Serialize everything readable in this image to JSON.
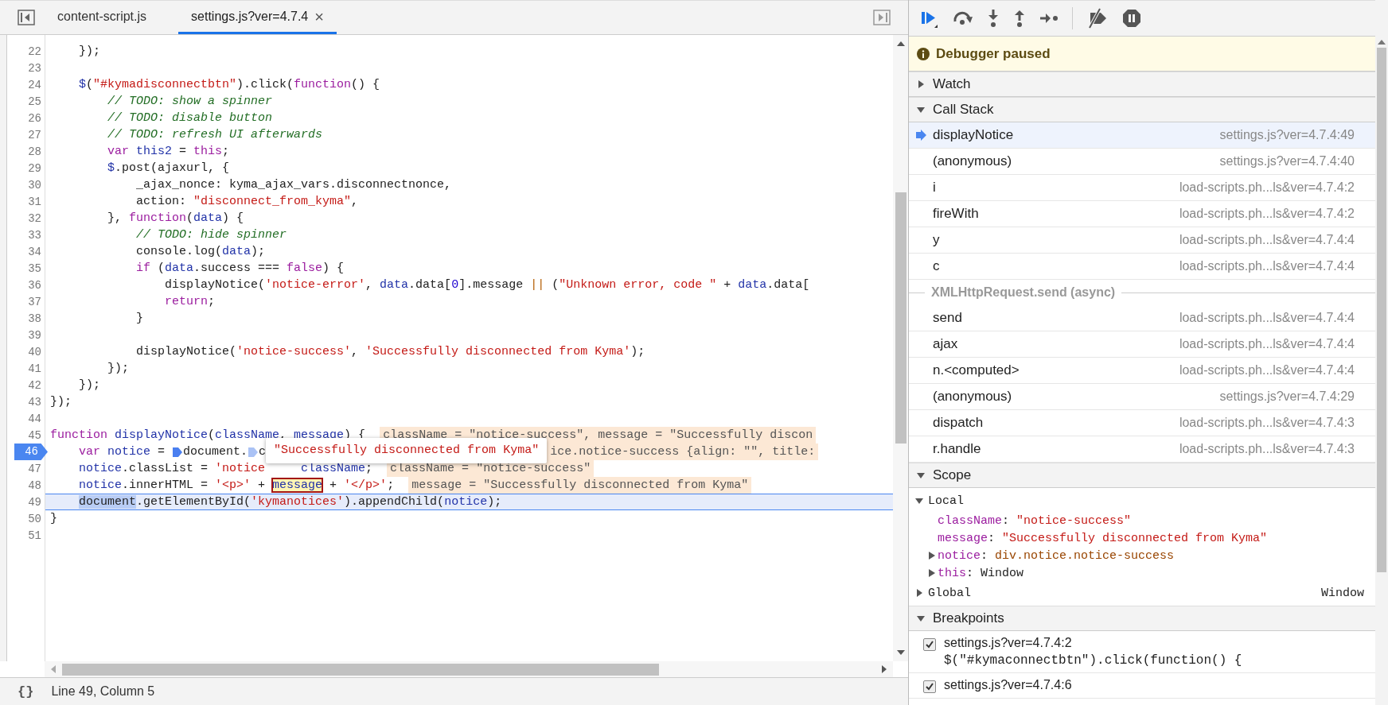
{
  "editor": {
    "tabs": [
      {
        "label": "content-script.js",
        "selected": false
      },
      {
        "label": "settings.js?ver=4.7.4",
        "selected": true,
        "close": "×"
      }
    ],
    "lines": [
      {
        "number": "22",
        "breakpoint": false,
        "current": false,
        "tokens": [
          {
            "kind": "plain",
            "text": "    });"
          }
        ]
      },
      {
        "number": "23",
        "breakpoint": false,
        "current": false
      },
      {
        "number": "24",
        "breakpoint": false,
        "current": false,
        "tokens": [
          {
            "kind": "variable",
            "text": "    $"
          },
          {
            "kind": "plain",
            "text": "("
          },
          {
            "kind": "string",
            "text": "\"#kymadisconnectbtn\""
          },
          {
            "kind": "plain",
            "text": ").click("
          },
          {
            "kind": "keyword",
            "text": "function"
          },
          {
            "kind": "plain",
            "text": "() {"
          }
        ]
      },
      {
        "number": "25",
        "breakpoint": false,
        "current": false,
        "tokens": [
          {
            "kind": "comment",
            "text": "        // TODO: show a spinner"
          }
        ]
      },
      {
        "number": "26",
        "breakpoint": false,
        "current": false,
        "tokens": [
          {
            "kind": "comment",
            "text": "        // TODO: disable button"
          }
        ]
      },
      {
        "number": "27",
        "breakpoint": false,
        "current": false,
        "tokens": [
          {
            "kind": "comment",
            "text": "        // TODO: refresh UI afterwards"
          }
        ]
      },
      {
        "number": "28",
        "breakpoint": false,
        "current": false,
        "tokens": [
          {
            "kind": "keyword",
            "text": "        var"
          },
          {
            "kind": "variable",
            "text": " this2"
          },
          {
            "kind": "plain",
            "text": " = "
          },
          {
            "kind": "keyword",
            "text": "this"
          },
          {
            "kind": "plain",
            "text": ";"
          }
        ]
      },
      {
        "number": "29",
        "breakpoint": false,
        "current": false,
        "tokens": [
          {
            "kind": "variable",
            "text": "        $"
          },
          {
            "kind": "plain",
            "text": ".post(ajaxurl, {"
          }
        ]
      },
      {
        "number": "30",
        "breakpoint": false,
        "current": false,
        "tokens": [
          {
            "kind": "plain",
            "text": "            _ajax_nonce: kyma_ajax_vars.disconnectnonce,"
          }
        ]
      },
      {
        "number": "31",
        "breakpoint": false,
        "current": false,
        "tokens": [
          {
            "kind": "plain",
            "text": "            action: "
          },
          {
            "kind": "string",
            "text": "\"disconnect_from_kyma\""
          },
          {
            "kind": "plain",
            "text": ","
          }
        ]
      },
      {
        "number": "32",
        "breakpoint": false,
        "current": false,
        "tokens": [
          {
            "kind": "plain",
            "text": "        }, "
          },
          {
            "kind": "keyword",
            "text": "function"
          },
          {
            "kind": "plain",
            "text": "("
          },
          {
            "kind": "variable",
            "text": "data"
          },
          {
            "kind": "plain",
            "text": ") {"
          }
        ]
      },
      {
        "number": "33",
        "breakpoint": false,
        "current": false,
        "tokens": [
          {
            "kind": "comment",
            "text": "            // TODO: hide spinner"
          }
        ]
      },
      {
        "number": "34",
        "breakpoint": false,
        "current": false,
        "tokens": [
          {
            "kind": "plain",
            "text": "            console.log("
          },
          {
            "kind": "variable",
            "text": "data"
          },
          {
            "kind": "plain",
            "text": ");"
          }
        ]
      },
      {
        "number": "35",
        "breakpoint": false,
        "current": false,
        "tokens": [
          {
            "kind": "keyword",
            "text": "            if"
          },
          {
            "kind": "plain",
            "text": " ("
          },
          {
            "kind": "variable",
            "text": "data"
          },
          {
            "kind": "plain",
            "text": ".success === "
          },
          {
            "kind": "keyword",
            "text": "false"
          },
          {
            "kind": "plain",
            "text": ") {"
          }
        ]
      },
      {
        "number": "36",
        "breakpoint": false,
        "current": false,
        "tokens": [
          {
            "kind": "plain",
            "text": "                displayNotice("
          },
          {
            "kind": "string",
            "text": "'notice-error'"
          },
          {
            "kind": "plain",
            "text": ", "
          },
          {
            "kind": "variable",
            "text": "data"
          },
          {
            "kind": "plain",
            "text": ".data["
          },
          {
            "kind": "number",
            "text": "0"
          },
          {
            "kind": "plain",
            "text": "].message "
          },
          {
            "kind": "operator",
            "text": "||"
          },
          {
            "kind": "plain",
            "text": " ("
          },
          {
            "kind": "string",
            "text": "\"Unknown error, code \""
          },
          {
            "kind": "plain",
            "text": " + "
          },
          {
            "kind": "variable",
            "text": "data"
          },
          {
            "kind": "plain",
            "text": ".data["
          }
        ]
      },
      {
        "number": "37",
        "breakpoint": false,
        "current": false,
        "tokens": [
          {
            "kind": "keyword",
            "text": "                return"
          },
          {
            "kind": "plain",
            "text": ";"
          }
        ]
      },
      {
        "number": "38",
        "breakpoint": false,
        "current": false,
        "tokens": [
          {
            "kind": "plain",
            "text": "            }"
          }
        ]
      },
      {
        "number": "39",
        "breakpoint": false,
        "current": false
      },
      {
        "number": "40",
        "breakpoint": false,
        "current": false,
        "tokens": [
          {
            "kind": "plain",
            "text": "            displayNotice("
          },
          {
            "kind": "string",
            "text": "'notice-success'"
          },
          {
            "kind": "plain",
            "text": ", "
          },
          {
            "kind": "string",
            "text": "'Successfully disconnected from Kyma'"
          },
          {
            "kind": "plain",
            "text": ");"
          }
        ]
      },
      {
        "number": "41",
        "breakpoint": false,
        "current": false,
        "tokens": [
          {
            "kind": "plain",
            "text": "        });"
          }
        ]
      },
      {
        "number": "42",
        "breakpoint": false,
        "current": false,
        "tokens": [
          {
            "kind": "plain",
            "text": "    });"
          }
        ]
      },
      {
        "number": "43",
        "breakpoint": false,
        "current": false,
        "tokens": [
          {
            "kind": "plain",
            "text": "});"
          }
        ]
      },
      {
        "number": "44",
        "breakpoint": false,
        "current": false
      },
      {
        "number": "45",
        "breakpoint": false,
        "current": false,
        "tokens": [
          {
            "kind": "keyword",
            "text": "function"
          },
          {
            "kind": "variable",
            "text": " displayNotice"
          },
          {
            "kind": "plain",
            "text": "("
          },
          {
            "kind": "variable",
            "text": "className"
          },
          {
            "kind": "plain",
            "text": ", "
          },
          {
            "kind": "variable",
            "text": "message"
          },
          {
            "kind": "plain",
            "text": ") {"
          }
        ],
        "inline_value": "className = \"notice-success\", message = \"Successfully discon"
      },
      {
        "number": "46",
        "breakpoint": true,
        "current": false,
        "tokens": [
          {
            "kind": "keyword",
            "text": "    var"
          },
          {
            "kind": "variable",
            "text": " notice"
          },
          {
            "kind": "plain",
            "text": " = "
          },
          {
            "kind": "marker",
            "active": true
          },
          {
            "kind": "plain",
            "text": "document."
          },
          {
            "kind": "marker",
            "active": false
          },
          {
            "kind": "plain",
            "text": "c"
          }
        ],
        "popover": "\"Successfully disconnected from Kyma\"",
        "inline_value": "ice.notice-success {align: \"\", title:"
      },
      {
        "number": "47",
        "breakpoint": false,
        "current": false,
        "tokens": [
          {
            "kind": "variable",
            "text": "    notice"
          },
          {
            "kind": "plain",
            "text": ".classList = "
          },
          {
            "kind": "string",
            "text": "'notice"
          },
          {
            "kind": "variable",
            "text": "     className"
          },
          {
            "kind": "plain",
            "text": ";"
          }
        ],
        "inline_value": "className = \"notice-success\""
      },
      {
        "number": "48",
        "breakpoint": false,
        "current": false,
        "tokens": [
          {
            "kind": "variable",
            "text": "    notice"
          },
          {
            "kind": "plain",
            "text": ".innerHTML = "
          },
          {
            "kind": "string",
            "text": "'<p>'"
          },
          {
            "kind": "plain",
            "text": " + "
          },
          {
            "kind": "hovered",
            "text": "message"
          },
          {
            "kind": "plain",
            "text": " + "
          },
          {
            "kind": "string",
            "text": "'</p>'"
          },
          {
            "kind": "plain",
            "text": ";"
          }
        ],
        "inline_value": "message = \"Successfully disconnected from Kyma\""
      },
      {
        "number": "49",
        "breakpoint": false,
        "current": true,
        "tokens": [
          {
            "kind": "selected",
            "text": "    document"
          },
          {
            "kind": "plain",
            "text": ".getElementById("
          },
          {
            "kind": "string",
            "text": "'kymanotices'"
          },
          {
            "kind": "plain",
            "text": ").appendChild("
          },
          {
            "kind": "variable",
            "text": "notice"
          },
          {
            "kind": "plain",
            "text": ");"
          }
        ]
      },
      {
        "number": "50",
        "breakpoint": false,
        "current": false,
        "tokens": [
          {
            "kind": "plain",
            "text": "}"
          }
        ]
      },
      {
        "number": "51",
        "breakpoint": false,
        "current": false
      }
    ],
    "status_bar": {
      "pretty_print": "{}",
      "position": "Line 49, Column 5"
    }
  },
  "debugger": {
    "banner": "Debugger paused",
    "watch": {
      "title": "Watch",
      "expanded": false
    },
    "call_stack": {
      "title": "Call Stack",
      "expanded": true,
      "frames": [
        {
          "kind": "frame",
          "name": "displayNotice",
          "location": "settings.js?ver=4.7.4:49",
          "selected": true
        },
        {
          "kind": "frame",
          "name": "(anonymous)",
          "location": "settings.js?ver=4.7.4:40",
          "selected": false
        },
        {
          "kind": "frame",
          "name": "i",
          "location": "load-scripts.ph...ls&ver=4.7.4:2",
          "selected": false
        },
        {
          "kind": "frame",
          "name": "fireWith",
          "location": "load-scripts.ph...ls&ver=4.7.4:2",
          "selected": false
        },
        {
          "kind": "frame",
          "name": "y",
          "location": "load-scripts.ph...ls&ver=4.7.4:4",
          "selected": false
        },
        {
          "kind": "frame",
          "name": "c",
          "location": "load-scripts.ph...ls&ver=4.7.4:4",
          "selected": false
        },
        {
          "kind": "async",
          "name": "XMLHttpRequest.send (async)"
        },
        {
          "kind": "frame",
          "name": "send",
          "location": "load-scripts.ph...ls&ver=4.7.4:4",
          "selected": false
        },
        {
          "kind": "frame",
          "name": "ajax",
          "location": "load-scripts.ph...ls&ver=4.7.4:4",
          "selected": false
        },
        {
          "kind": "frame",
          "name": "n.<computed>",
          "location": "load-scripts.ph...ls&ver=4.7.4:4",
          "selected": false
        },
        {
          "kind": "frame",
          "name": "(anonymous)",
          "location": "settings.js?ver=4.7.4:29",
          "selected": false
        },
        {
          "kind": "frame",
          "name": "dispatch",
          "location": "load-scripts.ph...ls&ver=4.7.4:3",
          "selected": false
        },
        {
          "kind": "frame",
          "name": "r.handle",
          "location": "load-scripts.ph...ls&ver=4.7.4:3",
          "selected": false
        }
      ]
    },
    "scope": {
      "title": "Scope",
      "expanded": true,
      "groups": [
        {
          "name": "Local",
          "expanded": true,
          "vars": [
            {
              "name": "className",
              "colon": ":",
              "value": "\"notice-success\"",
              "kind": "string",
              "expandable": false
            },
            {
              "name": "message",
              "colon": ":",
              "value": "\"Successfully disconnected from Kyma\"",
              "kind": "string",
              "expandable": false
            },
            {
              "name": "notice",
              "colon": ":",
              "value": "div.notice.notice-success",
              "kind": "node",
              "expandable": true
            },
            {
              "name": "this",
              "colon": ":",
              "value": "Window",
              "kind": "object",
              "expandable": true
            }
          ]
        },
        {
          "name": "Global",
          "expanded": false,
          "value": "Window"
        }
      ]
    },
    "breakpoints": {
      "title": "Breakpoints",
      "expanded": true,
      "items": [
        {
          "location": "settings.js?ver=4.7.4:2",
          "code": "$(\"#kymaconnectbtn\").click(function() {",
          "checked": true
        },
        {
          "location": "settings.js?ver=4.7.4:6",
          "checked": true
        }
      ]
    }
  }
}
